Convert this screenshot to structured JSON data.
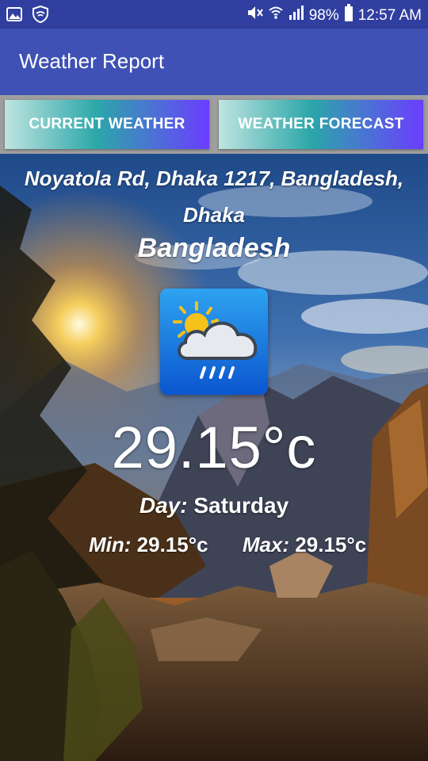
{
  "status_bar": {
    "icons_left": [
      "image-icon",
      "shield-icon"
    ],
    "icons_right": [
      "mute-icon",
      "wifi-icon",
      "signal-icon"
    ],
    "battery": "98%",
    "time": "12:57 AM"
  },
  "app_bar": {
    "title": "Weather Report"
  },
  "tabs": {
    "current_label": "CURRENT WEATHER",
    "forecast_label": "WEATHER FORECAST"
  },
  "weather": {
    "address_line1": "Noyatola Rd, Dhaka 1217, Bangladesh,",
    "address_line2": "Dhaka",
    "country": "Bangladesh",
    "condition_icon": "sun-cloud-rain-icon",
    "temperature": "29.15°c",
    "day_label": "Day:",
    "day_value": "Saturday",
    "min_label": "Min:",
    "min_value": "29.15°c",
    "max_label": "Max:",
    "max_value": "29.15°c"
  },
  "colors": {
    "status_bar": "#303f9f",
    "app_bar": "#3f51b5",
    "tab_gradient_start": "#bfe4e0",
    "tab_gradient_end": "#6b3dff"
  }
}
